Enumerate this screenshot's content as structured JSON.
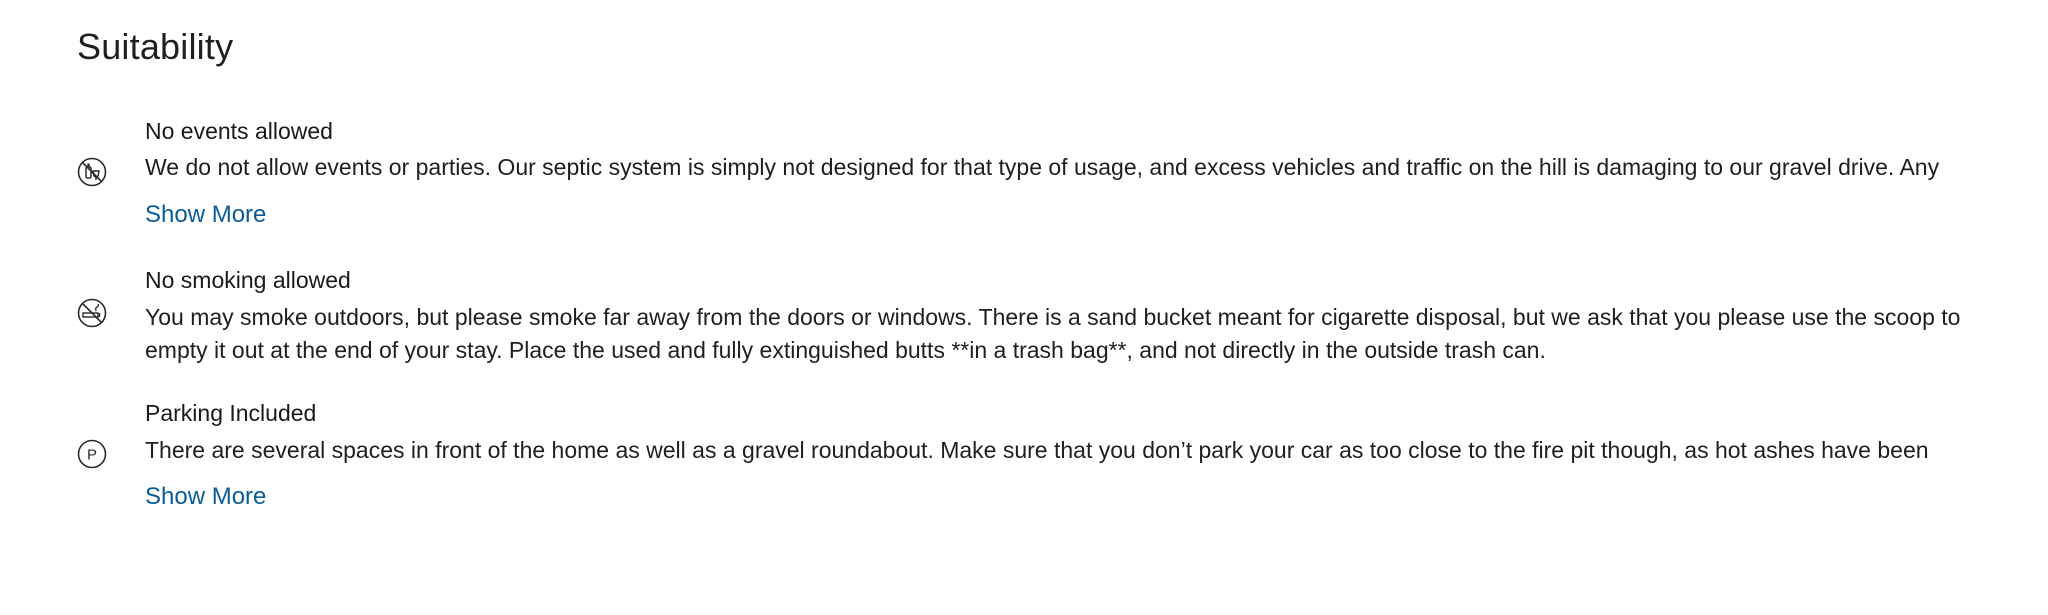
{
  "section": {
    "title": "Suitability"
  },
  "items": [
    {
      "icon": "no-events-icon",
      "title": "No events allowed",
      "text": "We do not allow events or parties. Our septic system is simply not designed for that type of usage, and excess vehicles and traffic on the hill is damaging to our gravel drive. Any",
      "show_more": "Show More"
    },
    {
      "icon": "no-smoking-icon",
      "title": "No smoking allowed",
      "text": "You may smoke outdoors, but please smoke far away from the doors or windows. There is a sand bucket meant for cigarette disposal, but we ask that you please use the scoop to empty it out at the end of your stay. Place the used and fully extinguished butts **in a trash bag**, and not directly in the outside trash can."
    },
    {
      "icon": "parking-icon",
      "title": "Parking Included",
      "text": "There are several spaces in front of the home as well as a gravel roundabout. Make sure that you don’t park your car as too close to the fire pit though, as hot ashes have been",
      "show_more": "Show More"
    }
  ],
  "colors": {
    "link": "#0b5c96",
    "text": "#1f1f1f"
  }
}
